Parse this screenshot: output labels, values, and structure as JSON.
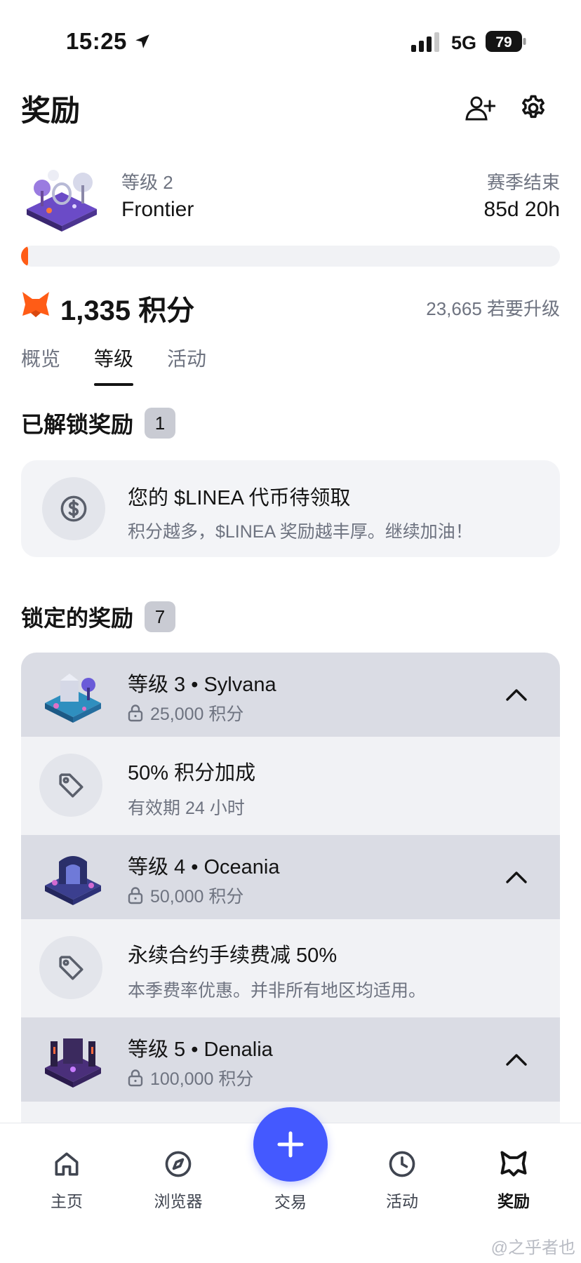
{
  "status_bar": {
    "time": "15:25",
    "network": "5G",
    "battery": "79"
  },
  "header": {
    "title": "奖励",
    "add_friend_icon": "person-add-icon",
    "settings_icon": "gear-icon"
  },
  "level": {
    "label": "等级 2",
    "name": "Frontier",
    "season_label": "赛季结束",
    "season_remaining": "85d 20h",
    "progress_fraction": 0.013
  },
  "points": {
    "value": "1,335 积分",
    "to_upgrade": "23,665 若要升级"
  },
  "tabs": [
    {
      "label": "概览",
      "active": false
    },
    {
      "label": "等级",
      "active": true
    },
    {
      "label": "活动",
      "active": false
    }
  ],
  "unlocked": {
    "title": "已解锁奖励",
    "count": "1",
    "item": {
      "title": "您的 $LINEA 代币待领取",
      "subtitle": "积分越多，$LINEA 奖励越丰厚。继续加油！",
      "icon": "dollar-coin-icon"
    }
  },
  "locked": {
    "title": "锁定的奖励",
    "count": "7",
    "tiers": [
      {
        "name": "等级 3 • Sylvana",
        "points": "25,000 积分",
        "reward_title": "50% 积分加成",
        "reward_subtitle": "有效期 24 小时"
      },
      {
        "name": "等级 4 • Oceania",
        "points": "50,000 积分",
        "reward_title": "永续合约手续费减 50%",
        "reward_subtitle": "本季费率优惠。并非所有地区均适用。"
      },
      {
        "name": "等级 5 • Denalia",
        "points": "100,000 积分"
      }
    ]
  },
  "nav": {
    "home": "主页",
    "browser": "浏览器",
    "trade": "交易",
    "activity": "活动",
    "rewards": "奖励"
  },
  "colors": {
    "accent": "#ff5c16",
    "fab": "#4459ff",
    "tier_header": "#dadce4"
  },
  "watermark": "@之乎者也"
}
